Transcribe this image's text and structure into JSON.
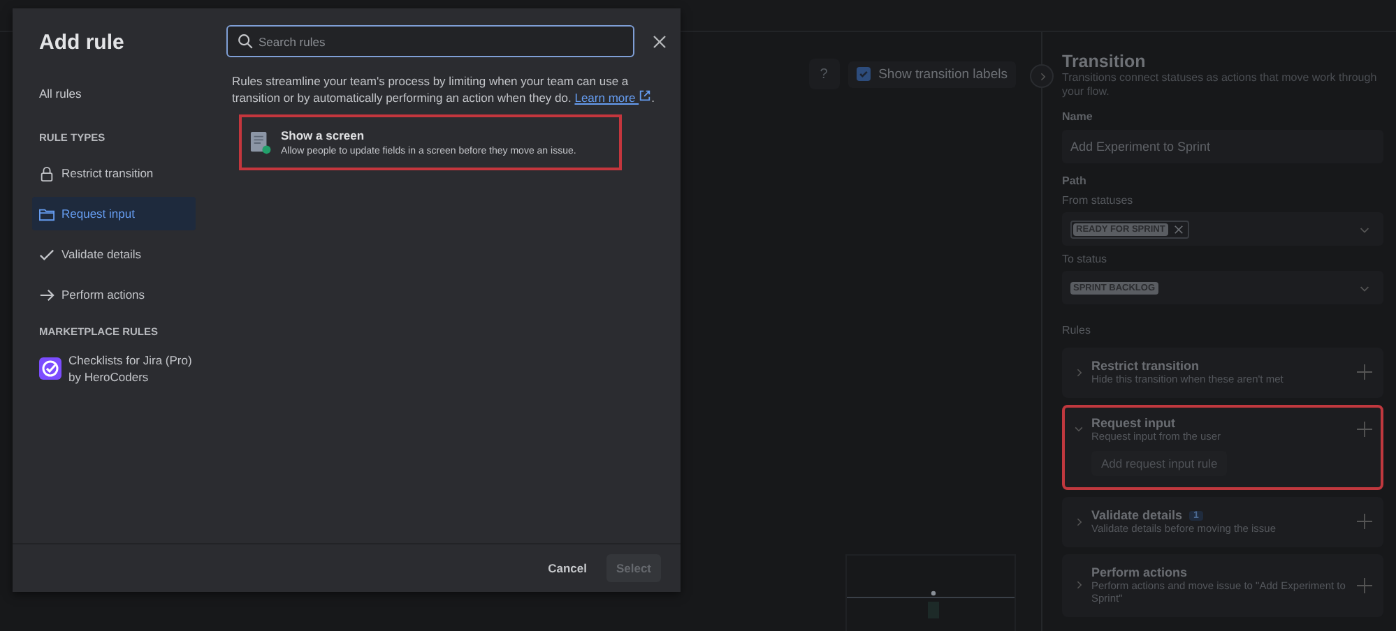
{
  "canvas": {
    "help_button": {
      "label": "?"
    },
    "show_labels": {
      "label": "Show transition labels",
      "checked": true
    }
  },
  "transition_panel": {
    "title": "Transition",
    "subtitle": "Transitions connect statuses as actions that move work through your flow.",
    "name_label": "Name",
    "name_value": "Add Experiment to Sprint",
    "path_label": "Path",
    "from_label": "From statuses",
    "from_tags": [
      "READY FOR SPRINT"
    ],
    "to_label": "To status",
    "to_value": "SPRINT BACKLOG",
    "rules_label": "Rules",
    "rules": [
      {
        "title": "Restrict transition",
        "description": "Hide this transition when these aren't met",
        "expanded": false,
        "highlighted": false
      },
      {
        "title": "Request input",
        "description": "Request input from the user",
        "expanded": true,
        "highlighted": true,
        "action": "Add request input rule"
      },
      {
        "title": "Validate details",
        "count": "1",
        "description": "Validate details before moving the issue",
        "expanded": false,
        "highlighted": false
      },
      {
        "title": "Perform actions",
        "description": "Perform actions and move issue to \"Add Experiment to Sprint\"",
        "expanded": false,
        "highlighted": false
      }
    ]
  },
  "modal": {
    "title": "Add rule",
    "all_rules": "All rules",
    "rule_types_heading": "RULE TYPES",
    "rule_types": [
      {
        "label": "Restrict transition",
        "kind": "lock",
        "selected": false
      },
      {
        "label": "Request input",
        "kind": "folder",
        "selected": true
      },
      {
        "label": "Validate details",
        "kind": "check",
        "selected": false
      },
      {
        "label": "Perform actions",
        "kind": "arrow",
        "selected": false
      }
    ],
    "marketplace_heading": "MARKETPLACE RULES",
    "marketplace": [
      {
        "label": "Checklists for Jira (Pro) by HeroCoders"
      }
    ],
    "search": {
      "placeholder": "Search rules"
    },
    "intro": "Rules streamline your team's process by limiting when your team can use a transition or by automatically performing an action when they do.",
    "learn_more": "Learn more",
    "intro_end": ".",
    "results": [
      {
        "title": "Show a screen",
        "description": "Allow people to update fields in a screen before they move an issue.",
        "highlighted": true
      }
    ],
    "buttons": {
      "cancel": "Cancel",
      "select": "Select",
      "select_disabled": true
    }
  }
}
